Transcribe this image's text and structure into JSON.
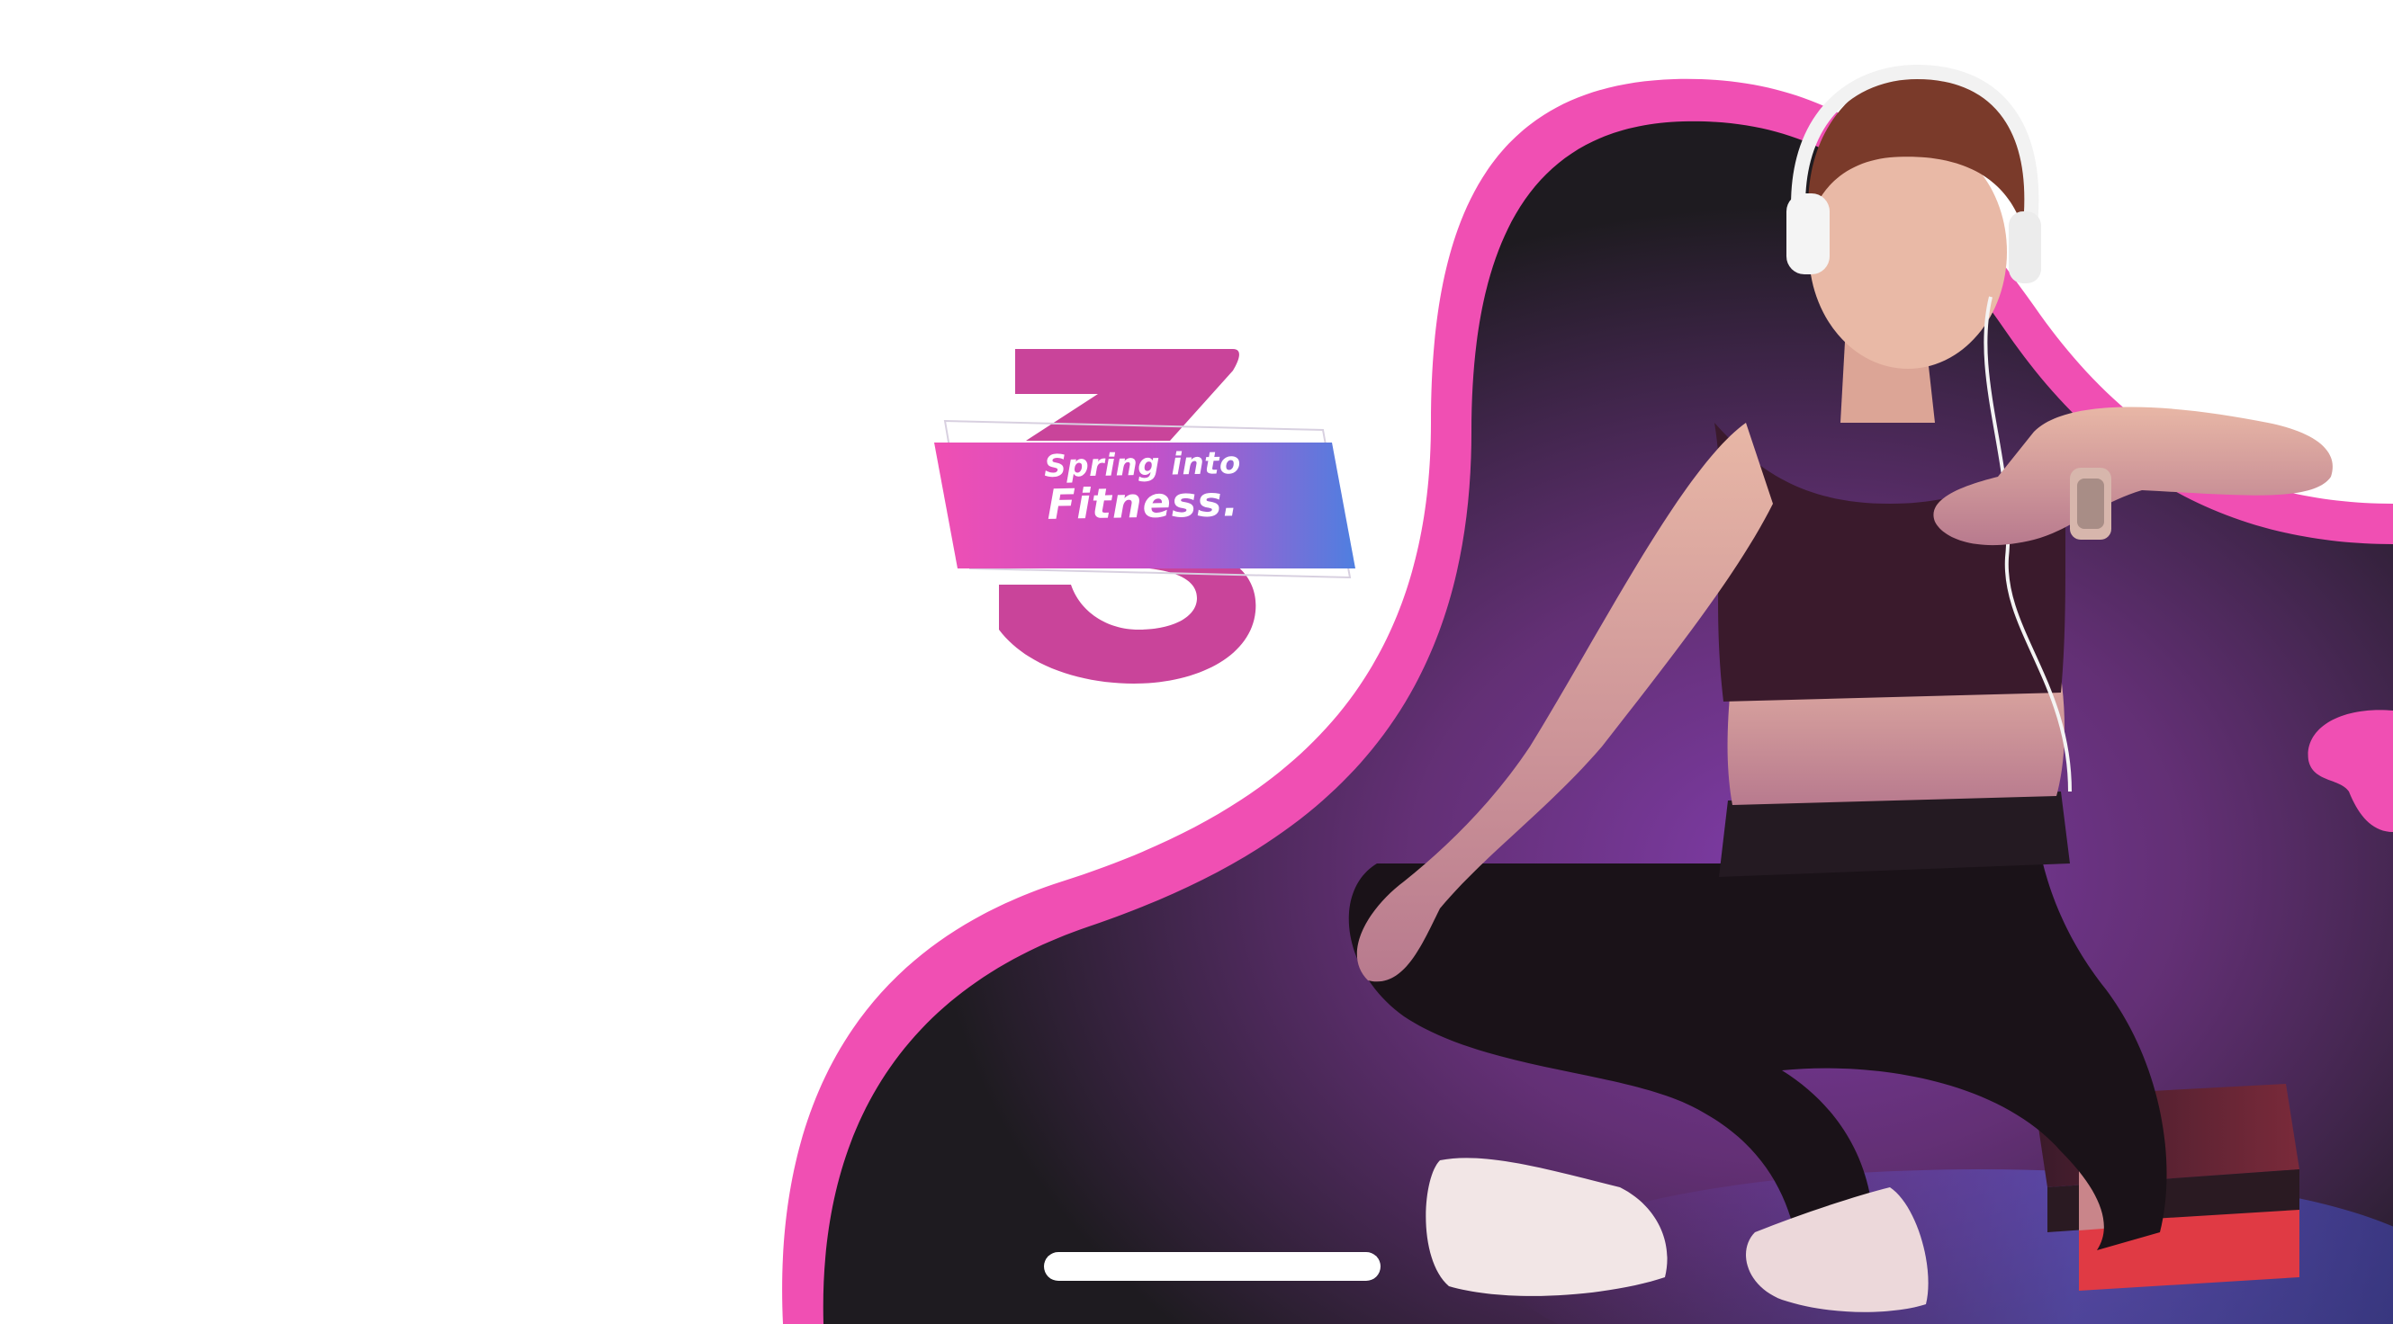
{
  "promo": {
    "step_number": "3",
    "headline_line1": "Spring into",
    "headline_line2": "Fitness."
  },
  "colors": {
    "accent_pink": "#F04FB3",
    "number_magenta": "#C9449A",
    "banner_blue": "#4F7FE0",
    "backdrop_dark": "#1E1B20",
    "glow_purple": "#7A3BA8",
    "background": "#FFFFFF"
  },
  "icons": {
    "headphones": "headphones-icon",
    "smartwatch": "smartwatch-icon"
  }
}
